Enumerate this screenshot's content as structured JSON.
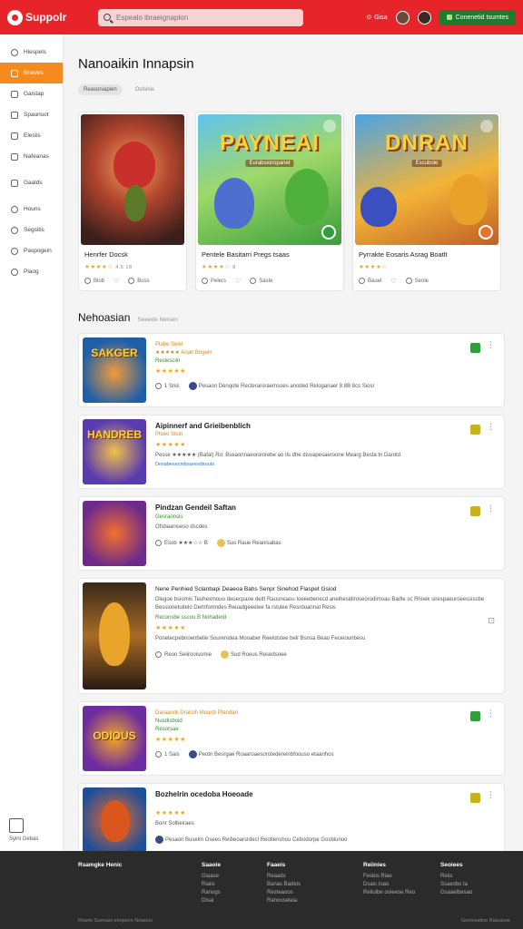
{
  "app": {
    "logo_text": "Suppolr"
  },
  "search": {
    "placeholder": "Espealo ibraeignaplon"
  },
  "topbar": {
    "link_label": "Gisa",
    "cta_label": "Conenetid tsumtes"
  },
  "sidebar": {
    "items": [
      {
        "label": "Hiespels",
        "icon": "home-icon"
      },
      {
        "label": "Brawes",
        "icon": "browse-icon"
      },
      {
        "label": "Gaistap",
        "icon": "games-icon"
      },
      {
        "label": "Spaunsot",
        "icon": "store-icon"
      },
      {
        "label": "Elesiis",
        "icon": "library-icon"
      },
      {
        "label": "Nafeanas",
        "icon": "news-icon"
      },
      {
        "label": "Gaalds",
        "icon": "group-icon"
      },
      {
        "label": "Houns",
        "icon": "friends-icon"
      },
      {
        "label": "Segsitis",
        "icon": "settings-icon"
      },
      {
        "label": "Paspogein",
        "icon": "help-icon"
      },
      {
        "label": "Piaog",
        "icon": "profile-icon"
      }
    ],
    "bottom_label": "Syini Gebas"
  },
  "main": {
    "title": "Nanoaikin Innapsin",
    "filters": [
      "Reasoniaplen",
      "Osfsinis"
    ]
  },
  "featured": [
    {
      "art_title": "",
      "art_sub": "",
      "title": "Henrfer Docsk",
      "rating_text": "★★★★☆",
      "rating_meta": "4.5  18",
      "likes": "Blob",
      "comments": "Buss"
    },
    {
      "art_title": "PAYNEAI",
      "art_sub": "Eurabsionspanet",
      "title": "Pentele Basitarri Pregs tsaas",
      "rating_text": "★★★★☆",
      "rating_meta": "8",
      "likes": "Pelers",
      "comments": "Sasle"
    },
    {
      "art_title": "DNRAN",
      "art_sub": "Escubole",
      "title": "Pyrrakte Eosaris Asrag Boatlt",
      "rating_text": "★★★★☆",
      "rating_meta": "",
      "likes": "Bauel",
      "comments": "Seole"
    }
  ],
  "section": {
    "title": "Nehoasian",
    "subtitle": "Seeede Neisen"
  },
  "list": [
    {
      "thumb_label": "SAKGER",
      "title": "Plabe Seiel",
      "meta": "★★★★★  Aoan Bngein",
      "genre": "Reslesciin",
      "stars": "★★★★★",
      "line": "",
      "tags": "",
      "foot1": "1 Snis",
      "foot2": "Pesaon Denqote Recteraroraemsoes anoded Reloganaer  8  8B 8cs Siosr"
    },
    {
      "thumb_label": "HANDREB",
      "title": "Aipinnerf and Grieibenblich",
      "meta": "Ptseo Stsin",
      "genre": "",
      "stars": "★★★★★",
      "line": "Pesse ★★★★★ (Bafal) Ro:  Bseaonnaeoroinrebe ao Ils dhe disvapesaeroone Mearg Besta tn Darotd",
      "tags": "Dnsabesecmbsaresdirouts",
      "foot1": "",
      "foot2": ""
    },
    {
      "thumb_label": "",
      "title": "Pindzan Gendeil Saftan",
      "meta": "Gesraonsis",
      "genre": "",
      "stars": "",
      "line": "Ofsbaaniseso dscdes",
      "tags": "",
      "foot1": "Esob  ★★★☆☆  B",
      "foot2": "Sus  Raue  Reanisabas"
    },
    {
      "thumb_label": "",
      "title": "Nene Penhied Sclanbapi Deaeoa Bahs Senpr Sinehod Flaspet Gsiod",
      "meta": "",
      "genre": "Reconsbe sscou B Nohaderd",
      "stars": "★★★★★",
      "line": "Dlegoe bsiomis Teuhexmouo deuecpaoe deitt Rausneaou Ioeeebenecd aneihesidiroseorodimoau Barlle sc Rhoek sirespaeuroeessissbe Bessionetuitelo Dertrfomndes Reuadgeeetee fa rstulee Resrdoarinat Resis",
      "tags": "Ponetecpebnoenbetie Sourenidea Mooaber Reelotstee belr  Bsnsa Beao  Feceiounbesu",
      "foot1": "Reon Seiirooisomie",
      "foot2": "Sud  Roeus  Resedsoee"
    },
    {
      "thumb_label": "ODIOUS",
      "title": "Daraandii Drairoh Moardi Ptandan",
      "meta": "Nusdisboid",
      "genre": "Resorsae",
      "stars": "★★★★★",
      "line": "",
      "tags": "",
      "foot1": "1 Sais",
      "foot2": "Peotn Besrgae Roaaroaesorotedereinbfoouso etaanhos"
    },
    {
      "thumb_label": "",
      "title": "Bozhelrin ocedoba Hoeoade",
      "meta": "",
      "genre": "",
      "stars": "★★★★★",
      "line": "Bonr  Solbeiraes",
      "tags": "",
      "foot1": "",
      "foot2": "Pesaon Buselm Gsees Reibeoarsrdecl Reotlenshou  Cebodorpe  Gosbiunuo"
    }
  ],
  "footer": {
    "cols": [
      {
        "head": "Rsamgke Henic",
        "items": []
      },
      {
        "head": "Saaoie",
        "items": [
          "Giaase",
          "Riaiis",
          "Ranogs",
          "Disai"
        ]
      },
      {
        "head": "Faaeis",
        "items": [
          "Reaads",
          "Banas Badeis",
          "Resteaoos",
          "Ranouseleia"
        ]
      },
      {
        "head": "Reiinies",
        "items": [
          "Fesbis Riae",
          "Dsais Ioao",
          "Reiloibe ooieese Reo"
        ]
      },
      {
        "head": "Seoiees",
        "items": [
          "Reiis",
          "Ssaeobs ta",
          "Gsaaeibesao"
        ]
      }
    ],
    "copyright": "Rearie Suenaoi eeopsno Nsiaoso",
    "copyright_right": "Goninsatioe Raiuasoe"
  },
  "colors": {
    "brand": "#e8242b",
    "accent": "#f58a1f",
    "cta": "#1f7a2e"
  }
}
